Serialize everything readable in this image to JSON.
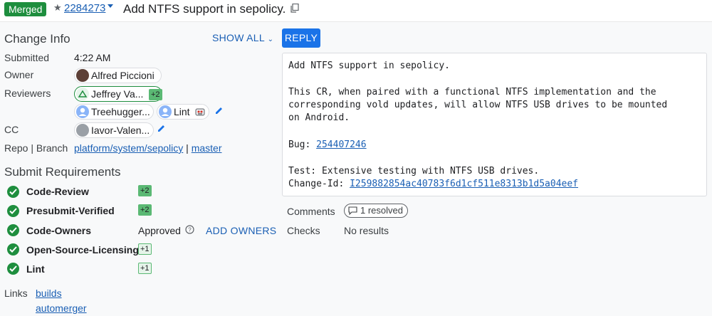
{
  "header": {
    "status": "Merged",
    "change_number": "2284273",
    "subject": "Add NTFS support in sepolicy."
  },
  "change_info": {
    "title": "Change Info",
    "show_all": "SHOW ALL",
    "submitted_label": "Submitted",
    "submitted_value": "4:22 AM",
    "owner_label": "Owner",
    "owner_name": "Alfred Piccioni",
    "reviewers_label": "Reviewers",
    "reviewer_1": "Jeffrey Va...",
    "reviewer_1_vote": "+2",
    "reviewer_2": "Treehugger...",
    "reviewer_3": "Lint",
    "cc_label": "CC",
    "cc_1": "Iavor-Valen...",
    "repo_label": "Repo | Branch",
    "repo": "platform/system/sepolicy",
    "repo_sep": "|",
    "branch": "master"
  },
  "submit_requirements": {
    "title": "Submit Requirements",
    "items": [
      {
        "name": "Code-Review",
        "value": "+2"
      },
      {
        "name": "Presubmit-Verified",
        "value": "+2"
      },
      {
        "name": "Code-Owners",
        "value": "Approved",
        "action": "ADD OWNERS"
      },
      {
        "name": "Open-Source-Licensing",
        "value": "+1"
      },
      {
        "name": "Lint",
        "value": "+1"
      }
    ]
  },
  "links": {
    "label": "Links",
    "items": [
      "builds",
      "automerger"
    ]
  },
  "reply_label": "REPLY",
  "commit_message": {
    "line1": "Add NTFS support in sepolicy.",
    "line2": "This CR, when paired with a functional NTFS implementation and the",
    "line3": "corresponding vold updates, will allow NTFS USB drives to be mounted",
    "line4": "on Android.",
    "bug_label": "Bug:",
    "bug_id": "254407246",
    "test_line": "Test: Extensive testing with NTFS USB drives.",
    "change_id_label": "Change-Id:",
    "change_id": "I259882854ac40783f6d1cf511e8313b1d5a04eef"
  },
  "comments": {
    "label": "Comments",
    "resolved": "1 resolved"
  },
  "checks": {
    "label": "Checks",
    "value": "No results"
  },
  "colors": {
    "merged_green": "#1e8e3e",
    "link_blue": "#1a5fb4",
    "reply_blue": "#1a73e8"
  }
}
